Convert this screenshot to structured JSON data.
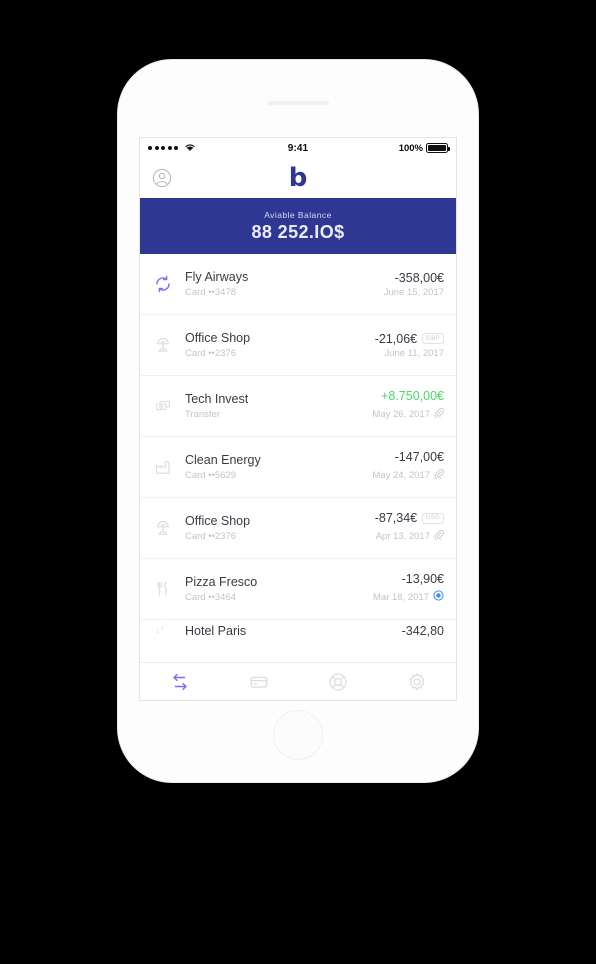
{
  "status_bar": {
    "signal_dots": 5,
    "wifi_icon": "wifi-icon",
    "time": "9:41",
    "battery_percent": "100%"
  },
  "app_header": {
    "profile_icon": "profile-avatar-icon",
    "logo": "b"
  },
  "balance": {
    "label": "Aviable Balance",
    "amount": "88 252.IO$",
    "accent_color": "#2f3795"
  },
  "transactions": [
    {
      "icon": "sync-arrows-icon",
      "icon_color": "#7c6ef0",
      "title": "Fly Airways",
      "subtitle": "Card ••3478",
      "amount": "-358,00€",
      "positive": false,
      "currency_badge": "",
      "date": "June 15, 2017",
      "trailing_icon": ""
    },
    {
      "icon": "desk-lamp-icon",
      "icon_color": "#dcdce2",
      "title": "Office Shop",
      "subtitle": "Card ••2376",
      "amount": "-21,06€",
      "positive": false,
      "currency_badge": "GBP",
      "date": "June 11, 2017",
      "trailing_icon": ""
    },
    {
      "icon": "banknotes-icon",
      "icon_color": "#dcdce2",
      "title": "Tech Invest",
      "subtitle": "Transfer",
      "amount": "+8.750,00€",
      "positive": true,
      "currency_badge": "",
      "date": "May 26, 2017",
      "trailing_icon": "paperclip-icon"
    },
    {
      "icon": "factory-icon",
      "icon_color": "#dcdce2",
      "title": "Clean Energy",
      "subtitle": "Card ••5629",
      "amount": "-147,00€",
      "positive": false,
      "currency_badge": "",
      "date": "May 24, 2017",
      "trailing_icon": "paperclip-icon"
    },
    {
      "icon": "desk-lamp-icon",
      "icon_color": "#dcdce2",
      "title": "Office Shop",
      "subtitle": "Card ••2376",
      "amount": "-87,34€",
      "positive": false,
      "currency_badge": "USD",
      "date": "Apr 13, 2017",
      "trailing_icon": "paperclip-icon"
    },
    {
      "icon": "fork-knife-icon",
      "icon_color": "#dcdce2",
      "title": "Pizza Fresco",
      "subtitle": "Card ••3464",
      "amount": "-13,90€",
      "positive": false,
      "currency_badge": "",
      "date": "Mar 18, 2017",
      "trailing_icon": "location-pin-icon"
    }
  ],
  "partial_transaction": {
    "icon": "sleep-zzz-icon",
    "title": "Hotel Paris",
    "amount": "-342,80"
  },
  "tab_bar": {
    "active_color": "#7c6ef0",
    "inactive_color": "#dcdce2",
    "tabs": [
      {
        "icon": "transfer-arrows-icon",
        "active": true
      },
      {
        "icon": "credit-card-icon",
        "active": false
      },
      {
        "icon": "support-lifebuoy-icon",
        "active": false
      },
      {
        "icon": "gear-icon",
        "active": false
      }
    ]
  }
}
